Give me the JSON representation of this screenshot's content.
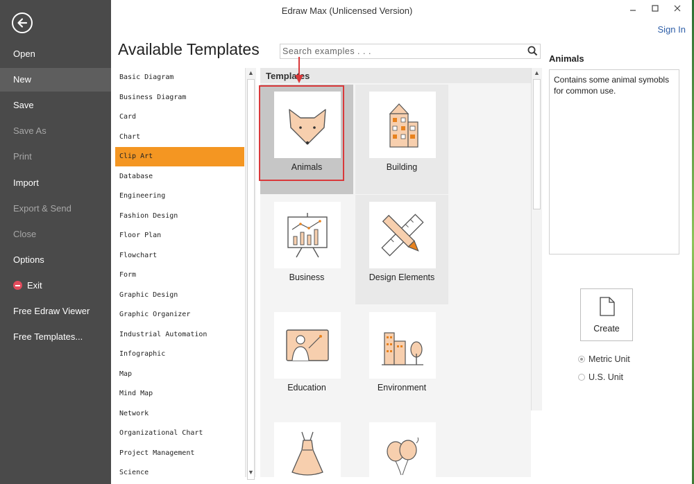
{
  "window": {
    "title": "Edraw Max (Unlicensed Version)",
    "sign_in": "Sign In"
  },
  "sidebar": {
    "items": [
      {
        "label": "Open"
      },
      {
        "label": "New"
      },
      {
        "label": "Save"
      },
      {
        "label": "Save As"
      },
      {
        "label": "Print"
      },
      {
        "label": "Import"
      },
      {
        "label": "Export & Send"
      },
      {
        "label": "Close"
      },
      {
        "label": "Options"
      },
      {
        "label": "Exit"
      },
      {
        "label": "Free Edraw Viewer"
      },
      {
        "label": "Free Templates..."
      }
    ]
  },
  "main": {
    "heading": "Available Templates",
    "search_placeholder": "Search examples . . .",
    "categories": [
      "Basic Diagram",
      "Business Diagram",
      "Card",
      "Chart",
      "Clip Art",
      "Database",
      "Engineering",
      "Fashion Design",
      "Floor Plan",
      "Flowchart",
      "Form",
      "Graphic Design",
      "Graphic Organizer",
      "Industrial Automation",
      "Infographic",
      "Map",
      "Mind Map",
      "Network",
      "Organizational Chart",
      "Project Management",
      "Science"
    ],
    "selected_category": "Clip Art",
    "templates_header": "Templates",
    "templates": [
      {
        "label": "Animals"
      },
      {
        "label": "Building"
      },
      {
        "label": "Business"
      },
      {
        "label": "Design Elements"
      },
      {
        "label": "Education"
      },
      {
        "label": "Environment"
      }
    ]
  },
  "info": {
    "title": "Animals",
    "description": "Contains some animal symobls for common use.",
    "create_label": "Create",
    "units": [
      {
        "label": "Metric Unit",
        "selected": true
      },
      {
        "label": "U.S. Unit",
        "selected": false
      }
    ]
  },
  "colors": {
    "accent": "#f49622",
    "sidebar": "#4a4a4a",
    "highlight": "#d9383a",
    "link": "#2f5fa8"
  }
}
